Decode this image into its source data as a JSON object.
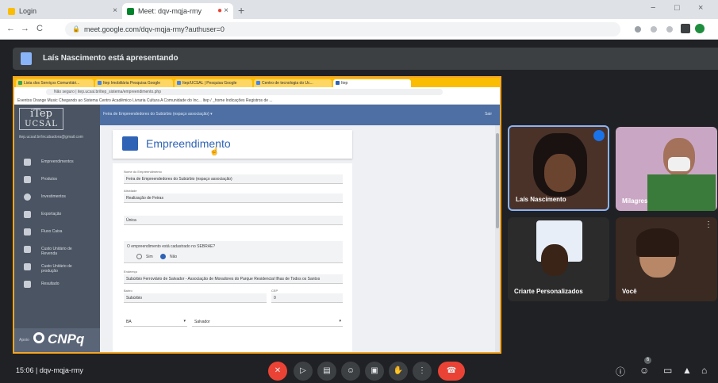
{
  "browser": {
    "tabs": [
      {
        "label": "Login",
        "icon": "yellow-tab-icon",
        "color": "#fbbc04"
      },
      {
        "label": "Meet: dqv-mqja-rmy",
        "icon": "meet-tab-icon",
        "color": "#00832d"
      }
    ],
    "new_tab": "+",
    "url": "meet.google.com/dqv-mqja-rmy?authuser=0",
    "nav": {
      "back": "←",
      "forward": "→",
      "reload": "C"
    },
    "window": {
      "minimize": "−",
      "maximize": "□",
      "close": "×"
    }
  },
  "presenter": {
    "text": "Laís Nascimento está apresentando"
  },
  "shared_screen": {
    "tabs": [
      "Lista dos Serviços Comunitári...",
      "Itep Imobiliária Pesquisa Google",
      "Itep/UCSAL | Pesquisa Google",
      "Centro de tecnologia do Uc...",
      "Itep"
    ],
    "url": "Não seguro | itep.ucsal.br/itep_sistema/empreendimento.php",
    "bookmarks": "Eventos   Orange Music   Chegando ao Sistema   Centro Acadêmico   Livraria Cultura   A Comunidade do Inc...   Itep / _home Indicações   Registros de ...",
    "logo": {
      "line1": "iTep",
      "line2": "UCSAL"
    },
    "email": "itep.ucsal.br/incubadora@gmail.com",
    "menu": [
      {
        "label": "Empreendimentos",
        "icon": "building-icon"
      },
      {
        "label": "Produtos",
        "icon": "tag-icon"
      },
      {
        "label": "Investimentos",
        "icon": "dollar-icon"
      },
      {
        "label": "Exportação",
        "icon": "chart-icon"
      },
      {
        "label": "Fluxo Caixa",
        "icon": "arrow-icon"
      },
      {
        "label": "Custo Unitário de Revenda",
        "icon": "cart-icon"
      },
      {
        "label": "Custo Unitário de produção",
        "icon": "trend-icon"
      },
      {
        "label": "Resultado",
        "icon": "result-icon"
      }
    ],
    "footer": {
      "apoio": "Apoio",
      "cnpq": "CNPq"
    },
    "topbar": {
      "title": "Feira de Empreendedores do Subúrbio (espaço associação) ▾",
      "right": "Sair"
    },
    "card_title": "Empreendimento",
    "form": {
      "name_label": "Nome do Empreendimento",
      "name_value": "Feira de Empreendedores do Subúrbio (espaço associação)",
      "activity_label": "Atividade",
      "activity_value": "Realização de Feiras",
      "type_value": "Única",
      "question": "O empreendimento está cadastrado no SEBRAE?",
      "opt_yes": "Sim",
      "opt_no": "Não",
      "address_label": "Endereço",
      "address_value": "Subúrbio Ferroviário de Salvador - Associação de Moradores do Parque Residencial Ilhas de Todos os Santos",
      "bairro_label": "Bairro",
      "bairro_value": "Subúrbio",
      "cep_label": "CEP",
      "cep_value": "0",
      "uf_value": "BA",
      "city_value": "Salvador"
    }
  },
  "participants": [
    {
      "name": "Laís Nascimento",
      "speaking": true
    },
    {
      "name": "Milagres",
      "speaking": false
    },
    {
      "name": "Criarte Personalizados",
      "speaking": false
    },
    {
      "name": "Você",
      "speaking": false
    }
  ],
  "bottom": {
    "time": "15:06",
    "separator": "|",
    "meeting_code": "dqv-mqja-rmy",
    "people_count": "6"
  },
  "colors": {
    "meet_bg": "#202124",
    "share_border": "#f5a623",
    "accent_blue": "#2f63b5",
    "end_call": "#ea4335"
  }
}
